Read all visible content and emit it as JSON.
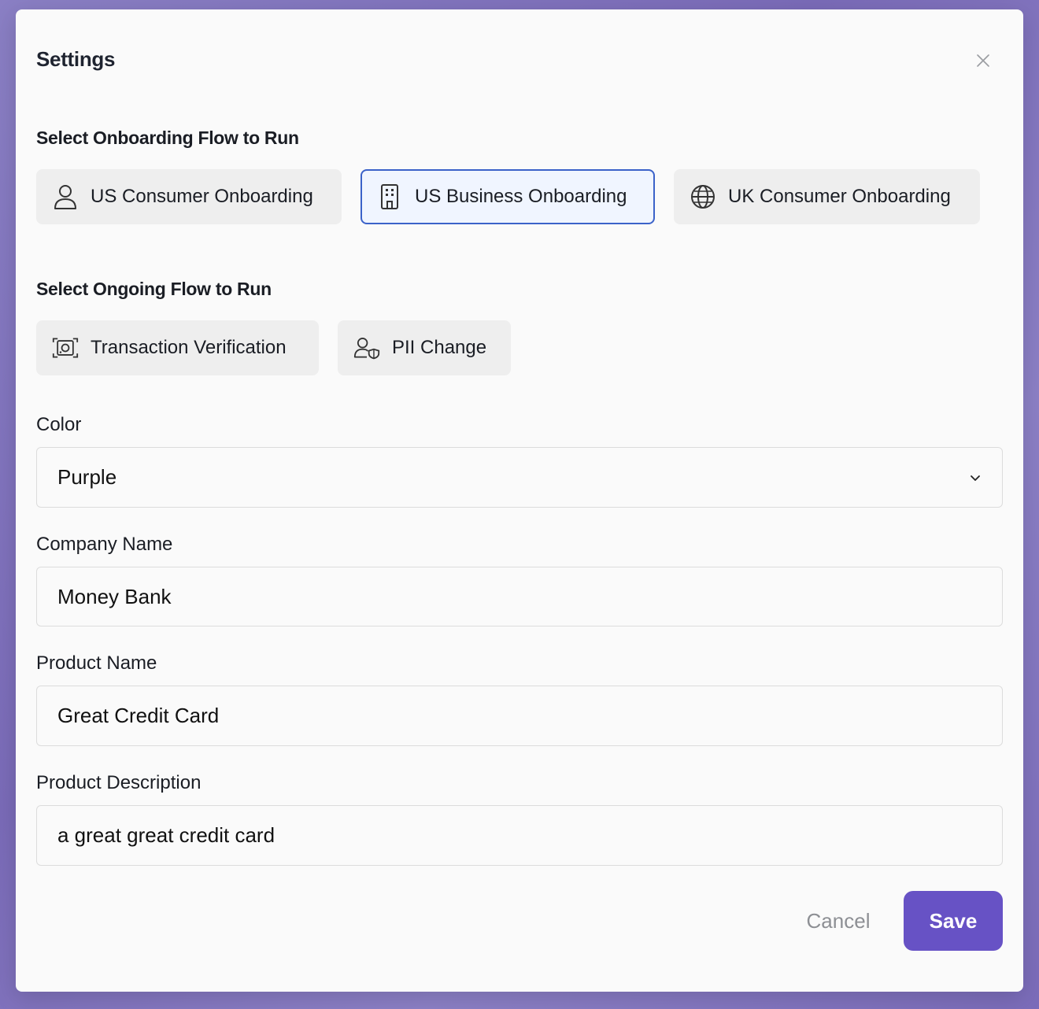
{
  "modal": {
    "title": "Settings",
    "close_icon": "close-icon"
  },
  "onboarding": {
    "title": "Select Onboarding Flow to Run",
    "options": [
      {
        "label": "US Consumer Onboarding",
        "icon": "user-icon",
        "selected": false
      },
      {
        "label": "US Business Onboarding",
        "icon": "building-icon",
        "selected": true
      },
      {
        "label": "UK Consumer Onboarding",
        "icon": "globe-icon",
        "selected": false
      }
    ]
  },
  "ongoing": {
    "title": "Select Ongoing Flow to Run",
    "options": [
      {
        "label": "Transaction Verification",
        "icon": "money-scan-icon",
        "selected": false
      },
      {
        "label": "PII Change",
        "icon": "user-shield-icon",
        "selected": false
      }
    ]
  },
  "form": {
    "color": {
      "label": "Color",
      "value": "Purple"
    },
    "company_name": {
      "label": "Company Name",
      "value": "Money Bank"
    },
    "product_name": {
      "label": "Product Name",
      "value": "Great Credit Card"
    },
    "product_description": {
      "label": "Product Description",
      "value": "a great great credit card"
    }
  },
  "actions": {
    "cancel_label": "Cancel",
    "save_label": "Save"
  },
  "colors": {
    "accent": "#6752c5",
    "selected_border": "#3b62c9",
    "selected_bg": "#f0f5ff",
    "backdrop": "#7a6bb8"
  }
}
